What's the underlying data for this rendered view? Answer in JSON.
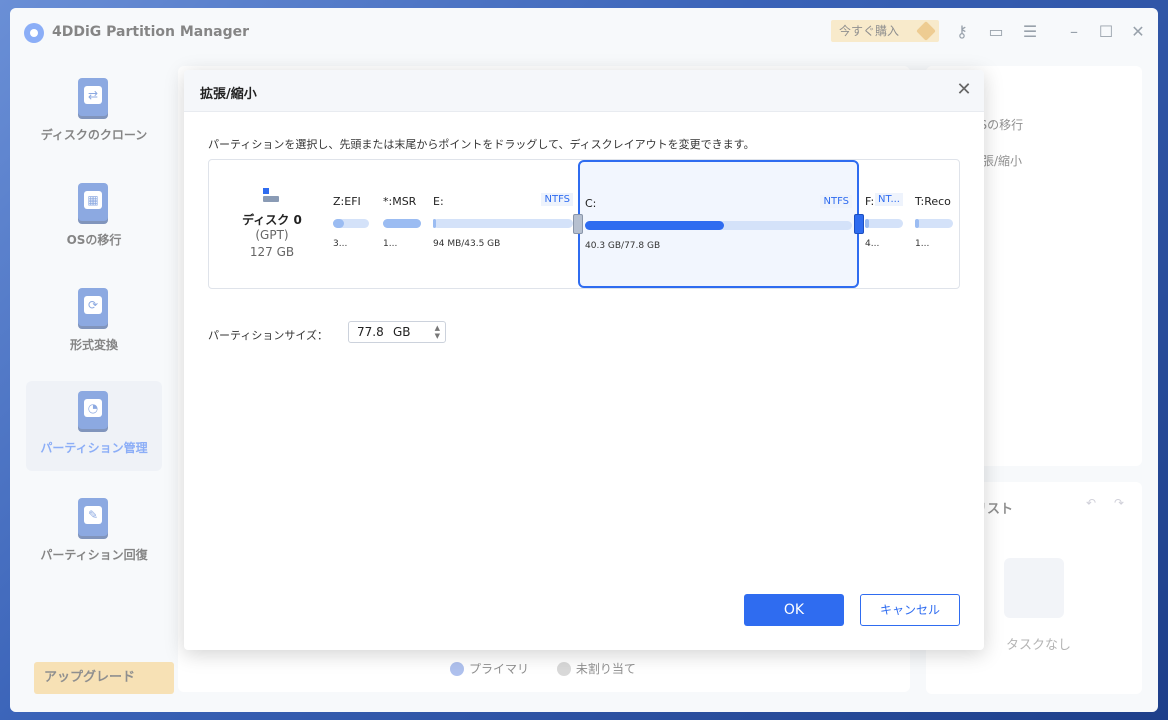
{
  "app": {
    "title": "4DDiG Partition Manager",
    "buy_label": "今すぐ購入",
    "upgrade_label": "アップグレード"
  },
  "sidebar": {
    "items": [
      {
        "label": "ディスクのクローン"
      },
      {
        "label": "OSの移行"
      },
      {
        "label": "形式変換"
      },
      {
        "label": "パーティション管理"
      },
      {
        "label": "パーティション回復"
      }
    ]
  },
  "legend": {
    "primary": "プライマリ",
    "unallocated": "未割り当て"
  },
  "right_panel": {
    "item1": "OSの移行",
    "item2": "張/縮小",
    "list_title": "リスト",
    "empty_text": "タスクなし"
  },
  "dialog": {
    "title": "拡張/縮小",
    "instruction": "パーティションを選択し、先頭または末尾からポイントをドラッグして、ディスクレイアウトを変更できます。",
    "disk": {
      "name": "ディスク 0",
      "type": "(GPT)",
      "size": "127 GB"
    },
    "partitions": [
      {
        "name": "Z:EFI",
        "fs": "",
        "usage": "3...",
        "fill": 0.3
      },
      {
        "name": "*:MSR",
        "fs": "",
        "usage": "1...",
        "fill": 1.0
      },
      {
        "name": "E:",
        "fs": "NTFS",
        "usage": "94 MB/43.5 GB",
        "fill": 0.02
      },
      {
        "name": "C:",
        "fs": "NTFS",
        "usage": "40.3 GB/77.8 GB",
        "fill": 0.52
      },
      {
        "name": "F:",
        "fs": "NT...",
        "usage": "4...",
        "fill": 0.1
      },
      {
        "name": "T:Reco",
        "fs": "",
        "usage": "1...",
        "fill": 0.1
      }
    ],
    "size_label": "パーティションサイズ：",
    "size_value": "77.8",
    "size_unit": "GB",
    "ok_label": "OK",
    "cancel_label": "キャンセル"
  }
}
